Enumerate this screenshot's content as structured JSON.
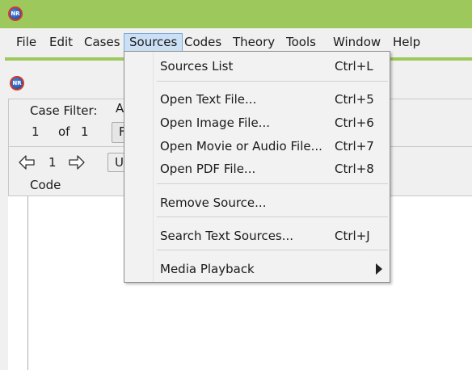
{
  "app": {
    "icon_text": "NR"
  },
  "menubar": {
    "items": [
      {
        "label": "File"
      },
      {
        "label": "Edit"
      },
      {
        "label": "Cases"
      },
      {
        "label": "Sources"
      },
      {
        "label": "Codes"
      },
      {
        "label": "Theory"
      },
      {
        "label": "Tools"
      },
      {
        "label": "Window"
      },
      {
        "label": "Help"
      }
    ]
  },
  "case_panel": {
    "case_filter_label": "Case Filter:",
    "case_filter_value_partial": "A",
    "index": "1",
    "of_label": "of",
    "total": "1",
    "button_partial": "F",
    "nav_index": "1",
    "dropdown_partial": "Ur",
    "column_header": "Code"
  },
  "sources_menu": {
    "items": [
      {
        "label": "Sources List",
        "accelerator": "Ctrl+L"
      },
      {
        "label": "Open Text File...",
        "accelerator": "Ctrl+5"
      },
      {
        "label": "Open Image File...",
        "accelerator": "Ctrl+6"
      },
      {
        "label": "Open Movie or Audio File...",
        "accelerator": "Ctrl+7"
      },
      {
        "label": "Open PDF File...",
        "accelerator": "Ctrl+8"
      },
      {
        "label": "Remove Source...",
        "accelerator": ""
      },
      {
        "label": "Search Text Sources...",
        "accelerator": "Ctrl+J"
      },
      {
        "label": "Media Playback",
        "accelerator": "",
        "submenu": true
      }
    ]
  }
}
